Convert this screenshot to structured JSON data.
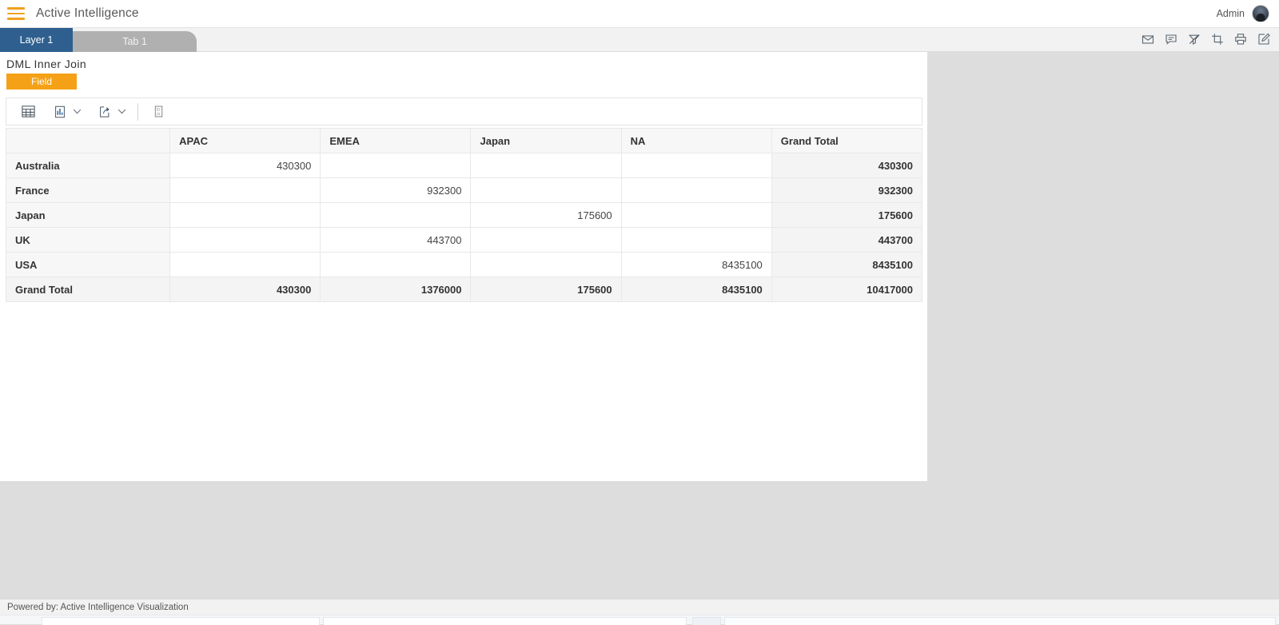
{
  "appbar": {
    "menu_icon": "hamburger-icon",
    "title": "Active Intelligence",
    "user_label": "Admin",
    "avatar_icon": "user-avatar"
  },
  "tabs": {
    "layer_label": "Layer 1",
    "page_label": "Tab 1",
    "actions": [
      {
        "name": "mail-icon",
        "title": "Mail"
      },
      {
        "name": "comment-icon",
        "title": "Comment"
      },
      {
        "name": "filter-off-icon",
        "title": "Clear Filter"
      },
      {
        "name": "crop-icon",
        "title": "Crop"
      },
      {
        "name": "print-icon",
        "title": "Print"
      },
      {
        "name": "edit-icon",
        "title": "Edit"
      }
    ]
  },
  "widget": {
    "title": "DML Inner Join",
    "field_button": "Field",
    "toolbar": [
      {
        "name": "table-view-icon",
        "title": "Table"
      },
      {
        "name": "bar-chart-icon",
        "title": "Chart"
      },
      {
        "name": "chevron-down-icon",
        "title": "Chart Options"
      },
      {
        "name": "export-icon",
        "title": "Export"
      },
      {
        "name": "chevron-down-icon",
        "title": "Export Options"
      },
      {
        "name": "script-icon",
        "title": "Script"
      }
    ]
  },
  "chart_data": {
    "type": "table",
    "title": "DML Inner Join",
    "columns": [
      "",
      "APAC",
      "EMEA",
      "Japan",
      "NA",
      "Grand Total"
    ],
    "rows": [
      {
        "label": "Australia",
        "values": [
          "430300",
          "",
          "",
          "",
          "430300"
        ]
      },
      {
        "label": "France",
        "values": [
          "",
          "932300",
          "",
          "",
          "932300"
        ]
      },
      {
        "label": "Japan",
        "values": [
          "",
          "",
          "175600",
          "",
          "175600"
        ]
      },
      {
        "label": "UK",
        "values": [
          "",
          "443700",
          "",
          "",
          "443700"
        ]
      },
      {
        "label": "USA",
        "values": [
          "",
          "",
          "",
          "8435100",
          "8435100"
        ]
      }
    ],
    "total_row": {
      "label": "Grand Total",
      "values": [
        "430300",
        "1376000",
        "175600",
        "8435100",
        "10417000"
      ]
    },
    "categories": [
      "Australia",
      "France",
      "Japan",
      "UK",
      "USA"
    ],
    "series": [
      {
        "name": "APAC",
        "values": [
          430300,
          null,
          null,
          null,
          null
        ]
      },
      {
        "name": "EMEA",
        "values": [
          null,
          932300,
          null,
          443700,
          null
        ]
      },
      {
        "name": "Japan",
        "values": [
          null,
          null,
          175600,
          null,
          null
        ]
      },
      {
        "name": "NA",
        "values": [
          null,
          null,
          null,
          null,
          8435100
        ]
      }
    ]
  },
  "footer": {
    "text": "Powered by: Active Intelligence Visualization"
  },
  "colors": {
    "accent_orange": "#f5a117",
    "layer_tab_blue": "#2e5f8f",
    "page_background": "#dddddd"
  }
}
